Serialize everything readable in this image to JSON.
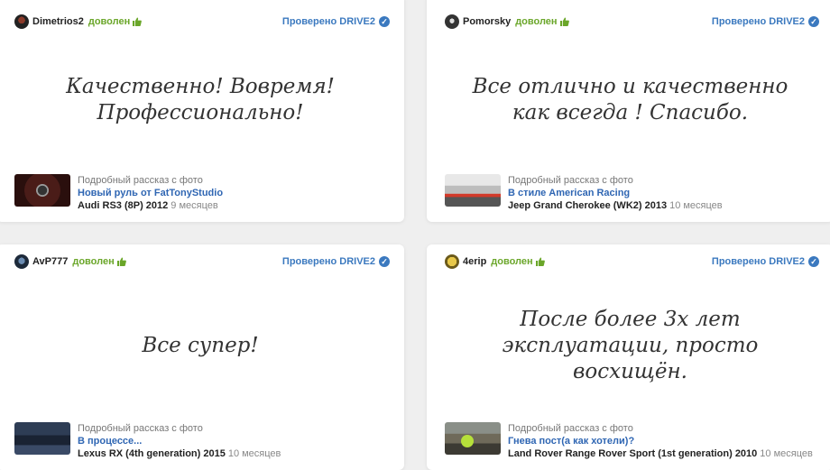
{
  "reviews": [
    {
      "user": "Dimetrios2",
      "mood": "доволен",
      "verified": "Проверено DRIVE2",
      "quote": "Качественно! Вовремя! Профессионально!",
      "story_label": "Подробный рассказ с фото",
      "story_title": "Новый руль от FatTonyStudio",
      "car": "Audi RS3 (8P) 2012",
      "age": "9 месяцев"
    },
    {
      "user": "Pomorsky",
      "mood": "доволен",
      "verified": "Проверено DRIVE2",
      "quote": "Все отлично и качественно как всегда ! Спасибо.",
      "story_label": "Подробный рассказ с фото",
      "story_title": "В стиле American Racing",
      "car": "Jeep Grand Cherokee (WK2) 2013",
      "age": "10 месяцев"
    },
    {
      "user": "AvP777",
      "mood": "доволен",
      "verified": "Проверено DRIVE2",
      "quote": "Все супер!",
      "story_label": "Подробный рассказ с фото",
      "story_title": "В процессе...",
      "car": "Lexus RX (4th generation) 2015",
      "age": "10 месяцев"
    },
    {
      "user": "4erip",
      "mood": "доволен",
      "verified": "Проверено DRIVE2",
      "quote": "После более 3х лет эксплуатации, просто восхищён.",
      "story_label": "Подробный рассказ с фото",
      "story_title": "Гнева пост(а как хотели)?",
      "car": "Land Rover Range Rover Sport (1st generation) 2010",
      "age": "10 месяцев"
    }
  ],
  "colors": {
    "mood": "#6aa629",
    "verified": "#3b79bf",
    "link": "#2f66b3"
  },
  "icons": {
    "mood": "thumbs-up-icon",
    "verified": "checkmark-circle-icon"
  }
}
